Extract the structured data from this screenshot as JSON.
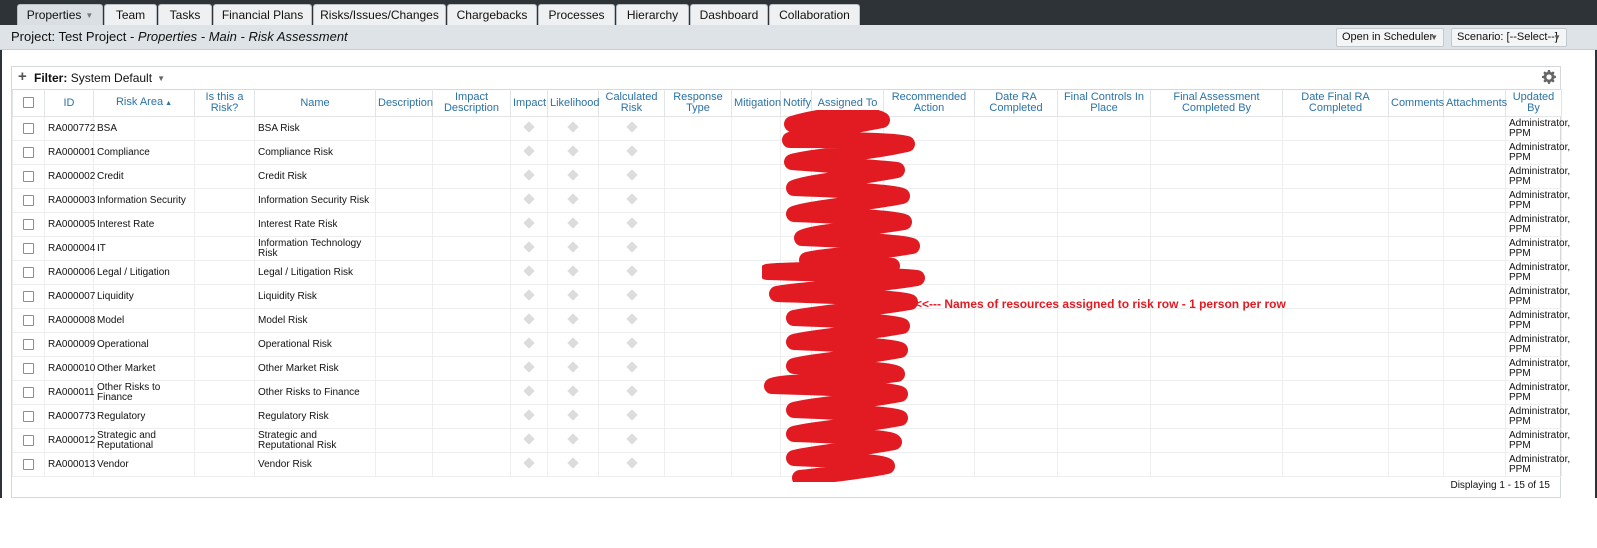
{
  "tabs": [
    {
      "label": "Properties",
      "active": true,
      "has_menu": true
    },
    {
      "label": "Team"
    },
    {
      "label": "Tasks"
    },
    {
      "label": "Financial Plans"
    },
    {
      "label": "Risks/Issues/Changes"
    },
    {
      "label": "Chargebacks"
    },
    {
      "label": "Processes"
    },
    {
      "label": "Hierarchy"
    },
    {
      "label": "Dashboard"
    },
    {
      "label": "Collaboration"
    }
  ],
  "header": {
    "project_prefix": "Project: Test Project - ",
    "page_path": "Properties - Main - Risk Assessment",
    "open_scheduler": "Open in Scheduler",
    "scenario": "Scenario: [--Select--]",
    "tool_icon": "wrench-icon"
  },
  "filter": {
    "label": "Filter:",
    "value": "System Default",
    "add_icon": "plus-icon",
    "options_icon": "gear-icon"
  },
  "columns": {
    "id": "ID",
    "risk_area": "Risk Area",
    "is_risk": "Is this a Risk?",
    "name": "Name",
    "description": "Description",
    "impact_description": "Impact Description",
    "impact": "Impact",
    "likelihood": "Likelihood",
    "calculated_risk": "Calculated Risk",
    "response_type": "Response Type",
    "mitigation": "Mitigation",
    "notify": "Notify",
    "assigned_to": "Assigned To",
    "recommended_action": "Recommended Action",
    "date_ra_completed": "Date RA Completed",
    "final_controls": "Final Controls In Place",
    "final_assessment_by": "Final Assessment Completed By",
    "date_final_ra": "Date Final RA Completed",
    "comments": "Comments",
    "attachments": "Attachments",
    "updated_by": "Updated By"
  },
  "rows": [
    {
      "id": "RA000772",
      "area": "BSA",
      "name": "BSA Risk",
      "updated_by": "Administrator, PPM"
    },
    {
      "id": "RA000001",
      "area": "Compliance",
      "name": "Compliance Risk",
      "updated_by": "Administrator, PPM"
    },
    {
      "id": "RA000002",
      "area": "Credit",
      "name": "Credit Risk",
      "updated_by": "Administrator, PPM"
    },
    {
      "id": "RA000003",
      "area": "Information Security",
      "name": "Information Security Risk",
      "updated_by": "Administrator, PPM"
    },
    {
      "id": "RA000005",
      "area": "Interest Rate",
      "name": "Interest Rate Risk",
      "updated_by": "Administrator, PPM"
    },
    {
      "id": "RA000004",
      "area": "IT",
      "name": "Information Technology Risk",
      "updated_by": "Administrator, PPM"
    },
    {
      "id": "RA000006",
      "area": "Legal / Litigation",
      "name": "Legal / Litigation Risk",
      "updated_by": "Administrator, PPM"
    },
    {
      "id": "RA000007",
      "area": "Liquidity",
      "name": "Liquidity Risk",
      "updated_by": "Administrator, PPM"
    },
    {
      "id": "RA000008",
      "area": "Model",
      "name": "Model Risk",
      "updated_by": "Administrator, PPM"
    },
    {
      "id": "RA000009",
      "area": "Operational",
      "name": "Operational Risk",
      "updated_by": "Administrator, PPM"
    },
    {
      "id": "RA000010",
      "area": "Other Market",
      "name": "Other Market Risk",
      "updated_by": "Administrator, PPM"
    },
    {
      "id": "RA000011",
      "area": "Other Risks to Finance",
      "name": "Other Risks to Finance",
      "updated_by": "Administrator, PPM"
    },
    {
      "id": "RA000773",
      "area": "Regulatory",
      "name": "Regulatory Risk",
      "updated_by": "Administrator, PPM"
    },
    {
      "id": "RA000012",
      "area": "Strategic and Reputational",
      "name": "Strategic and Reputational Risk",
      "updated_by": "Administrator, PPM"
    },
    {
      "id": "RA000013",
      "area": "Vendor",
      "name": "Vendor Risk",
      "updated_by": "Administrator, PPM"
    }
  ],
  "footer": "Displaying 1 - 15 of 15",
  "annotation": "<<<--- Names of resources assigned to risk row - 1 person per row",
  "colors": {
    "tab_bar": "#2e3338",
    "header_bar": "#dde3e6",
    "column_header_text": "#2b72a5",
    "link": "#1f5d95",
    "redaction": "#e21b23"
  }
}
